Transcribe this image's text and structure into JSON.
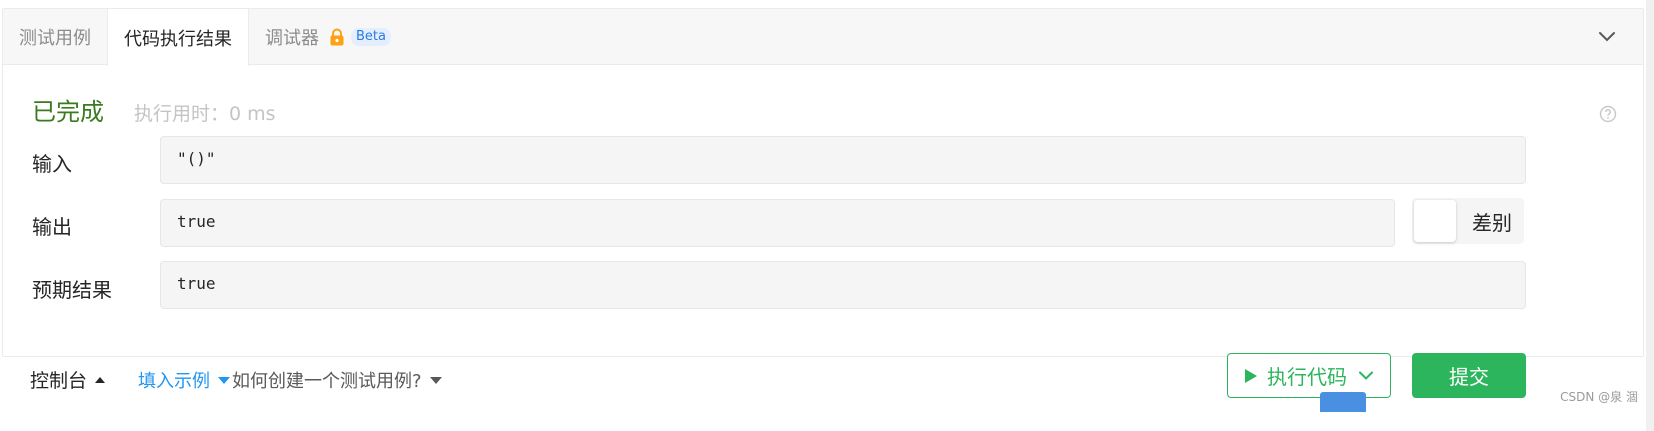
{
  "tabs": [
    {
      "label": "测试用例",
      "active": false
    },
    {
      "label": "代码执行结果",
      "active": true
    },
    {
      "label": "调试器",
      "active": false,
      "badge": "Beta",
      "icon": "lock-icon"
    }
  ],
  "result": {
    "status": "已完成",
    "exec_time": "执行用时：0 ms"
  },
  "fields": {
    "input_label": "输入",
    "input_value": "\"()\"",
    "output_label": "输出",
    "output_value": "true",
    "expected_label": "预期结果",
    "expected_value": "true",
    "diff_label": "差别"
  },
  "bottom": {
    "console_label": "控制台",
    "fill_example_label": "填入示例",
    "how_to_label": "如何创建一个测试用例?",
    "run_label": "执行代码",
    "submit_label": "提交"
  },
  "watermark": "CSDN @泉 涸",
  "colors": {
    "accent_green": "#2db55d",
    "status_green": "#3b7a1f",
    "link_blue": "#2196f3",
    "lock_orange": "#ffa116"
  }
}
